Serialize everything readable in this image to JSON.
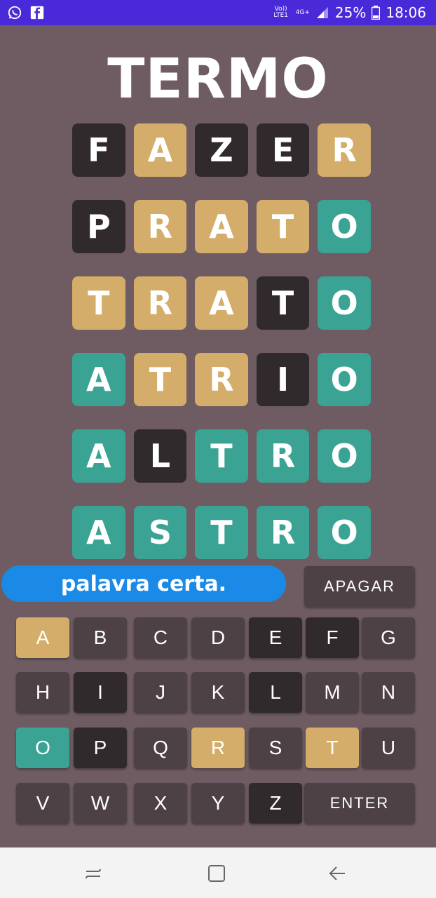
{
  "status_bar": {
    "left_icons": [
      "whatsapp-icon",
      "facebook-icon"
    ],
    "volte": "Vo)) LTE1",
    "network": "4G+",
    "battery": "25%",
    "time": "18:06"
  },
  "title": "TERMO",
  "board": {
    "rows": [
      [
        {
          "letter": "F",
          "state": "absent"
        },
        {
          "letter": "A",
          "state": "present"
        },
        {
          "letter": "Z",
          "state": "absent"
        },
        {
          "letter": "E",
          "state": "absent"
        },
        {
          "letter": "R",
          "state": "present"
        }
      ],
      [
        {
          "letter": "P",
          "state": "absent"
        },
        {
          "letter": "R",
          "state": "present"
        },
        {
          "letter": "A",
          "state": "present"
        },
        {
          "letter": "T",
          "state": "present"
        },
        {
          "letter": "O",
          "state": "correct"
        }
      ],
      [
        {
          "letter": "T",
          "state": "present"
        },
        {
          "letter": "R",
          "state": "present"
        },
        {
          "letter": "A",
          "state": "present"
        },
        {
          "letter": "T",
          "state": "absent"
        },
        {
          "letter": "O",
          "state": "correct"
        }
      ],
      [
        {
          "letter": "A",
          "state": "correct"
        },
        {
          "letter": "T",
          "state": "present"
        },
        {
          "letter": "R",
          "state": "present"
        },
        {
          "letter": "I",
          "state": "absent"
        },
        {
          "letter": "O",
          "state": "correct"
        }
      ],
      [
        {
          "letter": "A",
          "state": "correct"
        },
        {
          "letter": "L",
          "state": "absent"
        },
        {
          "letter": "T",
          "state": "correct"
        },
        {
          "letter": "R",
          "state": "correct"
        },
        {
          "letter": "O",
          "state": "correct"
        }
      ],
      [
        {
          "letter": "A",
          "state": "correct"
        },
        {
          "letter": "S",
          "state": "correct"
        },
        {
          "letter": "T",
          "state": "correct"
        },
        {
          "letter": "R",
          "state": "correct"
        },
        {
          "letter": "O",
          "state": "correct"
        }
      ]
    ]
  },
  "toast": "palavra certa.",
  "keyboard": {
    "delete_label": "APAGAR",
    "enter_label": "ENTER",
    "rows": [
      [
        {
          "k": "A",
          "s": "present"
        },
        {
          "k": "B",
          "s": "unused"
        },
        {
          "k": "C",
          "s": "unused"
        },
        {
          "k": "D",
          "s": "unused"
        },
        {
          "k": "E",
          "s": "absent"
        },
        {
          "k": "F",
          "s": "absent"
        },
        {
          "k": "G",
          "s": "unused"
        }
      ],
      [
        {
          "k": "H",
          "s": "unused"
        },
        {
          "k": "I",
          "s": "absent"
        },
        {
          "k": "J",
          "s": "unused"
        },
        {
          "k": "K",
          "s": "unused"
        },
        {
          "k": "L",
          "s": "absent"
        },
        {
          "k": "M",
          "s": "unused"
        },
        {
          "k": "N",
          "s": "unused"
        }
      ],
      [
        {
          "k": "O",
          "s": "correct"
        },
        {
          "k": "P",
          "s": "absent"
        },
        {
          "k": "Q",
          "s": "unused"
        },
        {
          "k": "R",
          "s": "present"
        },
        {
          "k": "S",
          "s": "unused"
        },
        {
          "k": "T",
          "s": "present"
        },
        {
          "k": "U",
          "s": "unused"
        }
      ],
      [
        {
          "k": "V",
          "s": "unused"
        },
        {
          "k": "W",
          "s": "unused"
        },
        {
          "k": "X",
          "s": "unused"
        },
        {
          "k": "Y",
          "s": "unused"
        },
        {
          "k": "Z",
          "s": "absent"
        }
      ]
    ]
  },
  "colors": {
    "absent": "#312a2c",
    "present": "#d3ad69",
    "correct": "#3aa394",
    "unused": "#4d4145",
    "background": "#6e5c62",
    "status_bar": "#4a2ad8",
    "toast": "#1a8ae6"
  },
  "nav_bar": {
    "buttons": [
      "recents-icon",
      "home-icon",
      "back-icon"
    ]
  }
}
